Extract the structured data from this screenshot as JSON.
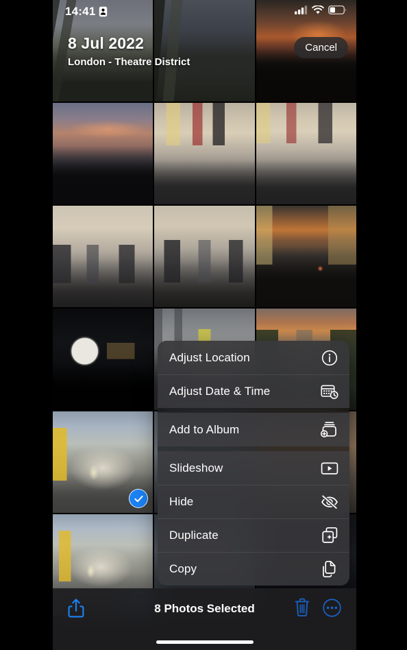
{
  "status_bar": {
    "time": "14:41",
    "lock_icon": "portrait-orientation-lock-icon",
    "signal_icon": "cellular-signal-icon",
    "wifi_icon": "wifi-icon",
    "battery_icon": "battery-icon"
  },
  "header": {
    "date": "8 Jul 2022",
    "location": "London - Theatre District"
  },
  "cancel_button": {
    "label": "Cancel"
  },
  "context_menu": {
    "groups": [
      {
        "items": [
          {
            "label": "Adjust Location",
            "icon": "info-circle-icon"
          },
          {
            "label": "Adjust Date & Time",
            "icon": "calendar-clock-icon"
          }
        ]
      },
      {
        "items": [
          {
            "label": "Add to Album",
            "icon": "album-add-icon"
          }
        ]
      },
      {
        "items": [
          {
            "label": "Slideshow",
            "icon": "play-rectangle-icon"
          },
          {
            "label": "Hide",
            "icon": "eye-slash-icon"
          },
          {
            "label": "Duplicate",
            "icon": "duplicate-icon"
          },
          {
            "label": "Copy",
            "icon": "copy-icon"
          }
        ]
      }
    ]
  },
  "toolbar": {
    "share_icon": "share-icon",
    "selection_count": "8 Photos Selected",
    "trash_icon": "trash-icon",
    "more_icon": "more-circle-icon",
    "accent_color": "#1b82f5"
  },
  "grid": {
    "columns": 3,
    "photos": [
      {
        "art": "ph-rails",
        "selected": false
      },
      {
        "art": "ph-track-dark",
        "selected": false
      },
      {
        "art": "ph-sunset-dome",
        "selected": false
      },
      {
        "art": "ph-sunset-sky",
        "selected": false
      },
      {
        "art": "ph-museum",
        "selected": false
      },
      {
        "art": "ph-museum2",
        "selected": false
      },
      {
        "art": "ph-crowd",
        "selected": false
      },
      {
        "art": "ph-crowd2",
        "selected": false
      },
      {
        "art": "ph-street-sunset",
        "selected": false
      },
      {
        "art": "ph-cinema",
        "selected": false
      },
      {
        "art": "ph-construction",
        "selected": false
      },
      {
        "art": "ph-park-sunset",
        "selected": false
      },
      {
        "art": "ph-arch1",
        "selected": true
      },
      {
        "art": "ph-generic-a",
        "selected": false
      },
      {
        "art": "ph-generic-b",
        "selected": false
      },
      {
        "art": "ph-arch2",
        "selected": true
      },
      {
        "art": "ph-generic-c",
        "selected": false
      },
      {
        "art": "ph-dark-room",
        "selected": false
      }
    ]
  }
}
